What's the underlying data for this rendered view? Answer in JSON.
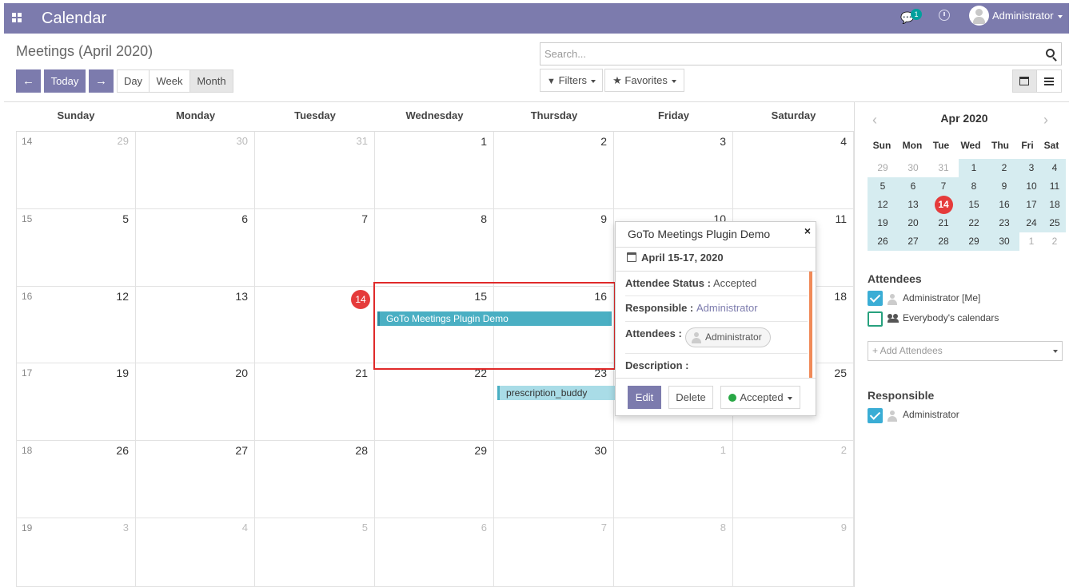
{
  "topbar": {
    "app_title": "Calendar",
    "chat_count": "1",
    "user_name": "Administrator"
  },
  "control_panel": {
    "breadcrumb": "Meetings (April 2020)",
    "today_label": "Today",
    "prev_symbol": "←",
    "next_symbol": "→",
    "scale_day": "Day",
    "scale_week": "Week",
    "scale_month": "Month",
    "search_placeholder": "Search...",
    "filters_label": "Filters",
    "favorites_label": "Favorites"
  },
  "calendar": {
    "weekdays": [
      "Sunday",
      "Monday",
      "Tuesday",
      "Wednesday",
      "Thursday",
      "Friday",
      "Saturday"
    ],
    "weeks": [
      {
        "num": "14",
        "days": [
          "29",
          "30",
          "31",
          "1",
          "2",
          "3",
          "4"
        ],
        "other": [
          true,
          true,
          true,
          false,
          false,
          false,
          false
        ]
      },
      {
        "num": "15",
        "days": [
          "5",
          "6",
          "7",
          "8",
          "9",
          "10",
          "11"
        ],
        "other": [
          false,
          false,
          false,
          false,
          false,
          false,
          false
        ]
      },
      {
        "num": "16",
        "days": [
          "12",
          "13",
          "14",
          "15",
          "16",
          "17",
          "18"
        ],
        "other": [
          false,
          false,
          false,
          false,
          false,
          false,
          false
        ]
      },
      {
        "num": "17",
        "days": [
          "19",
          "20",
          "21",
          "22",
          "23",
          "24",
          "25"
        ],
        "other": [
          false,
          false,
          false,
          false,
          false,
          false,
          false
        ]
      },
      {
        "num": "18",
        "days": [
          "26",
          "27",
          "28",
          "29",
          "30",
          "1",
          "2"
        ],
        "other": [
          false,
          false,
          false,
          false,
          false,
          true,
          true
        ]
      },
      {
        "num": "19",
        "days": [
          "3",
          "4",
          "5",
          "6",
          "7",
          "8",
          "9"
        ],
        "other": [
          true,
          true,
          true,
          true,
          true,
          true,
          true
        ]
      }
    ],
    "today": "14",
    "events": {
      "goto_meeting": "GoTo Meetings Plugin Demo",
      "prescription": "prescription_buddy"
    }
  },
  "popover": {
    "title": "GoTo Meetings Plugin Demo",
    "close_symbol": "×",
    "date": "April 15-17, 2020",
    "status_label": "Attendee Status :",
    "status_value": "Accepted",
    "responsible_label": "Responsible :",
    "responsible_value": "Administrator",
    "attendees_label": "Attendees :",
    "attendee_name": "Administrator",
    "description_label": "Description :",
    "edit_label": "Edit",
    "delete_label": "Delete",
    "accepted_label": "Accepted"
  },
  "sidebar": {
    "month_label": "Apr 2020",
    "prev_symbol": "‹",
    "next_symbol": "›",
    "weekdays": [
      "Sun",
      "Mon",
      "Tue",
      "Wed",
      "Thu",
      "Fri",
      "Sat"
    ],
    "weeks": [
      [
        "29",
        "30",
        "31",
        "1",
        "2",
        "3",
        "4"
      ],
      [
        "5",
        "6",
        "7",
        "8",
        "9",
        "10",
        "11"
      ],
      [
        "12",
        "13",
        "14",
        "15",
        "16",
        "17",
        "18"
      ],
      [
        "19",
        "20",
        "21",
        "22",
        "23",
        "24",
        "25"
      ],
      [
        "26",
        "27",
        "28",
        "29",
        "30",
        "1",
        "2"
      ]
    ],
    "attendees_heading": "Attendees",
    "attendee_me": "Administrator [Me]",
    "everybody": "Everybody's calendars",
    "add_attendees_placeholder": "+ Add Attendees",
    "responsible_heading": "Responsible",
    "responsible_name": "Administrator"
  },
  "colors": {
    "brand": "#7c7bad",
    "event": "#4aafc3",
    "today": "#e53b3b",
    "highlight": "#e02a2a"
  }
}
